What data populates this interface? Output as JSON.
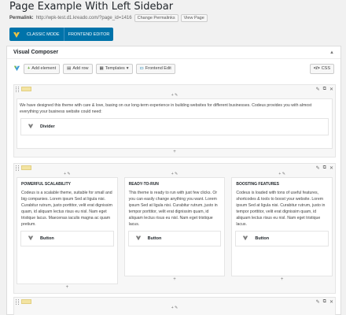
{
  "page": {
    "title": "Page Example With Left Sidebar",
    "permalink_label": "Permalink:",
    "permalink_url": "http://wpk-test.d1.kreado.com/?page_id=1416",
    "change_permalinks": "Change Permalinks",
    "view_page": "View Page"
  },
  "modebar": {
    "classic": "CLASSIC MODE",
    "frontend": "FRONTEND EDITOR"
  },
  "panel": {
    "title": "Visual Composer"
  },
  "toolbar": {
    "add_element": "Add element",
    "add_row": "Add row",
    "templates": "Templates",
    "frontend_edit": "Frontend Edit",
    "css": "CSS"
  },
  "row1": {
    "text": "We have designed this theme with care & love, basing on our long-term experience in building websites for different businesses. Codeus provides you with almost everything your business website could need:",
    "divider": "Divider"
  },
  "row2": {
    "cols": [
      {
        "heading": "POWERFUL SCALABILITY",
        "text": "Codeus is a scalable theme, suitable for small and big companies. Lorem ipsum Sed at ligula nisi. Curabitur rutrum, justo porttitor, velit erat dignissim quam, id aliquam lectus risus eu nisl. Nam eget tristique lacus. Maecenas iaculis magna ac quam pretium.",
        "button": "Button"
      },
      {
        "heading": "READY-TO-RUN",
        "text": "This theme is ready to run with just few clicks. Or you can easily change anything you want. Lorem ipsum Sed at ligula nisi. Curabitur rutrum, justo in tempor porttitor, velit erat dignissim quam, id aliquam lectus risus eu nisl. Nam eget tristique lacus.",
        "button": "Button"
      },
      {
        "heading": "BOOSTING FEATURES",
        "text": "Codeus is loaded with tons of useful features, shortcodes & tools to boost your website. Lorem ipsum Sed at ligula nisi. Curabitur rutrum, justo in tempor porttitor, velit erat dignissim quam, id aliquam lectus risus eu nisl. Nam eget tristique lacus.",
        "button": "Button"
      }
    ]
  }
}
